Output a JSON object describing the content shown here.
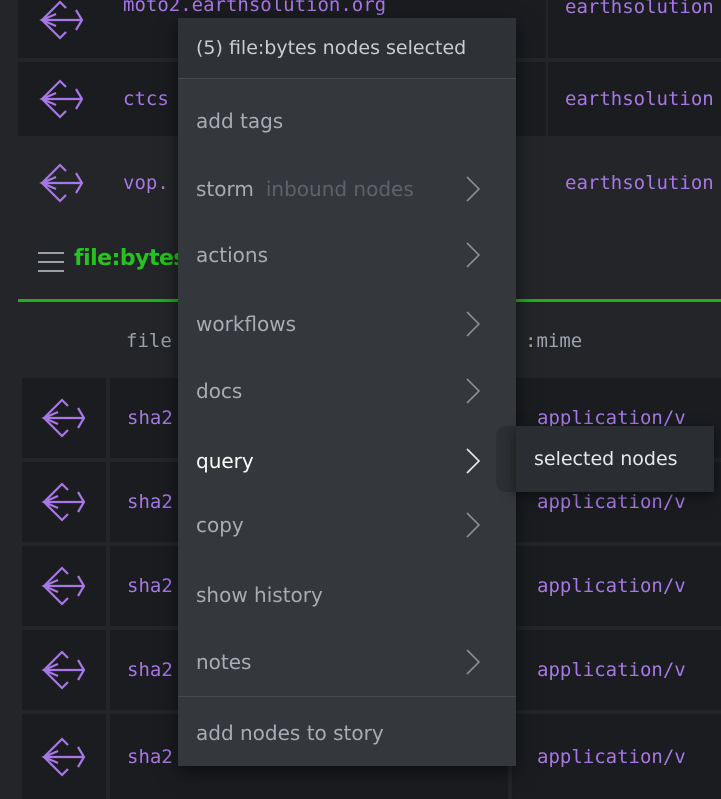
{
  "top_rows": [
    {
      "col1": "moto2.earthsolution.org",
      "col2": "earthsolution"
    },
    {
      "col1": "ctcs",
      "col2": "earthsolution"
    },
    {
      "col1": "vop.",
      "col2": "earthsolution"
    }
  ],
  "section": {
    "title": "file:bytes",
    "columns": [
      "file",
      ":mime"
    ]
  },
  "rows": [
    {
      "hash": "sha2",
      "mime": "application/v"
    },
    {
      "hash": "sha2",
      "mime": "application/v"
    },
    {
      "hash": "sha2",
      "mime": "application/v"
    },
    {
      "hash": "sha2",
      "mime": "application/v"
    },
    {
      "hash": "sha2",
      "mime": "application/v"
    }
  ],
  "menu": {
    "header": "(5) file:bytes nodes selected",
    "items": [
      {
        "label": "add tags",
        "hint": "",
        "has_submenu": false
      },
      {
        "label": "storm",
        "hint": "inbound nodes",
        "has_submenu": true
      },
      {
        "label": "actions",
        "hint": "",
        "has_submenu": true
      },
      {
        "label": "workflows",
        "hint": "",
        "has_submenu": true
      },
      {
        "label": "docs",
        "hint": "",
        "has_submenu": true
      },
      {
        "label": "query",
        "hint": "",
        "has_submenu": true,
        "active": true
      },
      {
        "label": "copy",
        "hint": "",
        "has_submenu": true
      },
      {
        "label": "show history",
        "hint": "",
        "has_submenu": false
      },
      {
        "label": "notes",
        "hint": "",
        "has_submenu": true
      },
      {
        "label": "add nodes to story",
        "hint": "",
        "has_submenu": false
      }
    ]
  },
  "submenu": {
    "items": [
      "selected nodes"
    ]
  },
  "colors": {
    "accent_green": "#26c21f",
    "node_purple": "#a777e6",
    "menu_bg": "#34373c"
  },
  "icons": {
    "node": "node-graph-icon",
    "menu": "hamburger-menu-icon",
    "chevron": "chevron-right-icon"
  }
}
